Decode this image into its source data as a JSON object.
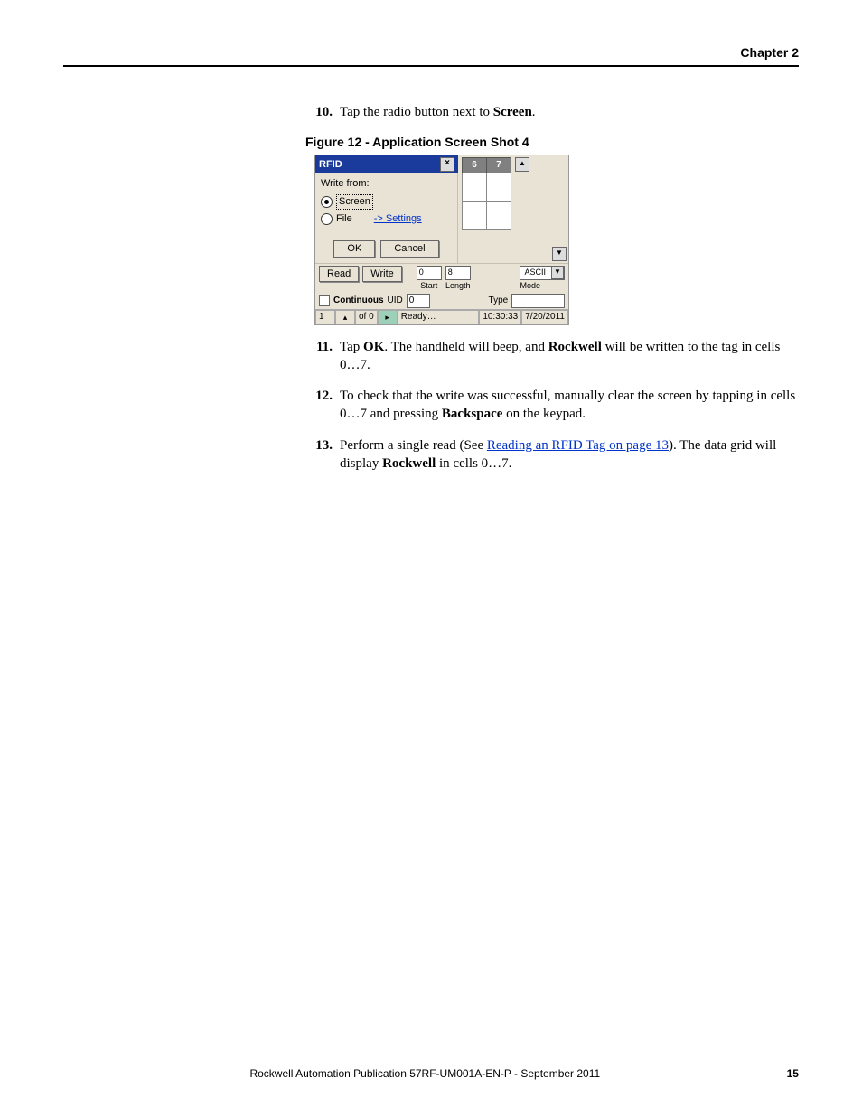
{
  "header": {
    "chapter": "Chapter 2"
  },
  "steps": {
    "s10": {
      "num": "10.",
      "pre": "Tap the radio button next to ",
      "bold": "Screen",
      "post": "."
    },
    "s11": {
      "num": "11.",
      "pre": "Tap ",
      "bold1": "OK",
      "mid": ". The handheld will beep, and ",
      "bold2": "Rockwell",
      "post": " will be written to the tag in cells 0…7."
    },
    "s12": {
      "num": "12.",
      "pre": "To check that the write was successful, manually clear the screen by tapping in cells 0…7 and pressing ",
      "bold": "Backspace",
      "post": " on the keypad."
    },
    "s13": {
      "num": "13.",
      "pre": "Perform a single read (See ",
      "link": "Reading an RFID Tag on page 13",
      "mid": "). The data grid will display ",
      "bold": "Rockwell",
      "post": " in cells 0…7."
    }
  },
  "figure": {
    "caption": "Figure 12 - Application Screen Shot 4"
  },
  "mock": {
    "title": "RFID",
    "writefrom": "Write from:",
    "screen": "Screen",
    "file": "File",
    "settings": "-> Settings",
    "ok": "OK",
    "cancel": "Cancel",
    "col6": "6",
    "col7": "7",
    "read": "Read",
    "write": "Write",
    "start_val": "0",
    "start_lbl": "Start",
    "length_val": "8",
    "length_lbl": "Length",
    "ascii": "ASCII",
    "mode": "Mode",
    "continuous": "Continuous",
    "uid": "UID",
    "uid_val": "0",
    "type": "Type",
    "page_val": "1",
    "page_of": "of 0",
    "ready": "Ready…",
    "time": "10:30:33",
    "date": "7/20/2011"
  },
  "footer": {
    "pub": "Rockwell Automation Publication 57RF-UM001A-EN-P - September 2011",
    "page": "15"
  }
}
